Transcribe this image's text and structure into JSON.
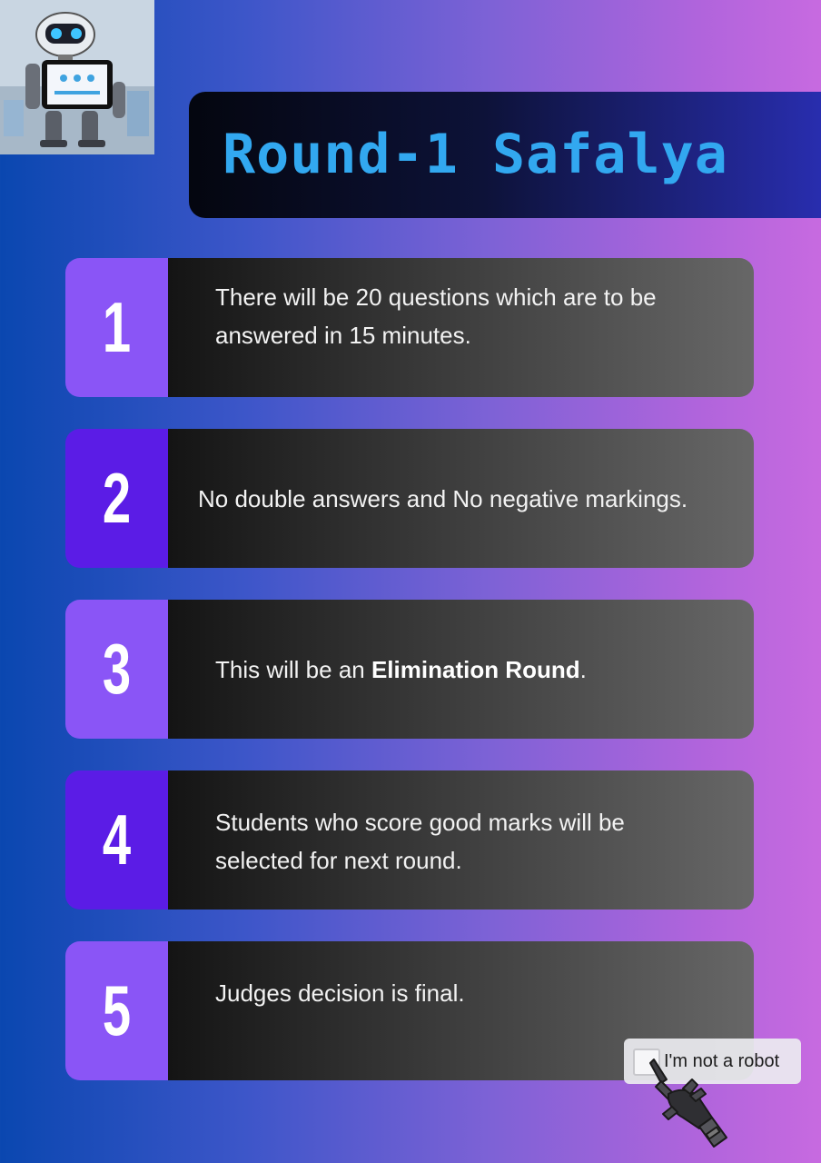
{
  "title": "Round-1 Safalya",
  "rules": [
    {
      "number": "1",
      "text": "There will be 20 questions which are to be answered in 15 minutes."
    },
    {
      "number": "2",
      "text": "No double answers and No negative markings."
    },
    {
      "number": "3",
      "text_before": "This will be an ",
      "text_bold": "Elimination Round",
      "text_after": "."
    },
    {
      "number": "4",
      "text": "Students who score good marks will be selected for next round."
    },
    {
      "number": "5",
      "text": "Judges decision is final."
    }
  ],
  "captcha": {
    "label": "I'm not a robot"
  },
  "icons": {
    "robot_image": "robot-with-tablet-illustration",
    "hand_image": "robotic-hand-pointing-icon"
  },
  "colors": {
    "title_text": "#32a8f0",
    "number_panel_light": "#8a55f6",
    "number_panel_dark": "#5b1ce6",
    "card_text": "#f2f2f2"
  }
}
